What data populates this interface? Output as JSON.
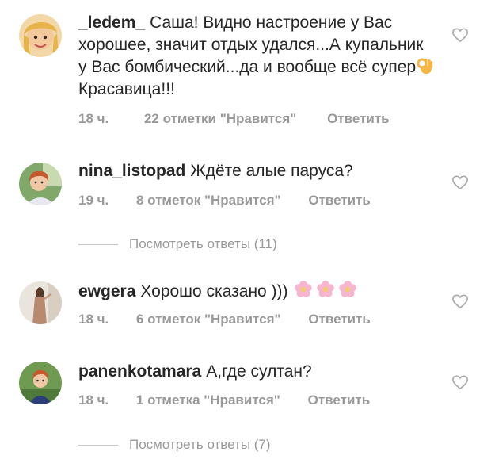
{
  "comments": [
    {
      "username": "_ledem_",
      "text": "Саша! Видно настроение у Вас хорошее, значит отдых удался...А купальник у Вас бомбический...да и вообще всё супер",
      "emoji_after": "ok-hand-emoji",
      "text_tail": "Красавица!!!",
      "time": "18 ч.",
      "likes": "22 отметки \"Нравится\"",
      "reply_label": "Ответить"
    },
    {
      "username": "nina_listopad",
      "text": "Ждёте алые паруса?",
      "time": "19 ч.",
      "likes": "8 отметок \"Нравится\"",
      "reply_label": "Ответить",
      "view_replies": "Посмотреть ответы (11)"
    },
    {
      "username": "ewgera",
      "text": "Хорошо сказано )))",
      "emoji_after": "cherry-blossom-emoji x3",
      "time": "18 ч.",
      "likes": "6 отметок \"Нравится\"",
      "reply_label": "Ответить"
    },
    {
      "username": "panenkotamara",
      "text": "А,где султан?",
      "time": "18 ч.",
      "likes": "1 отметка \"Нравится\"",
      "reply_label": "Ответить",
      "view_replies": "Посмотреть ответы (7)"
    }
  ],
  "icons": {
    "like": "heart-outline-icon"
  },
  "colors": {
    "text": "#262626",
    "meta": "#999999",
    "divider": "#c7c7c7"
  }
}
